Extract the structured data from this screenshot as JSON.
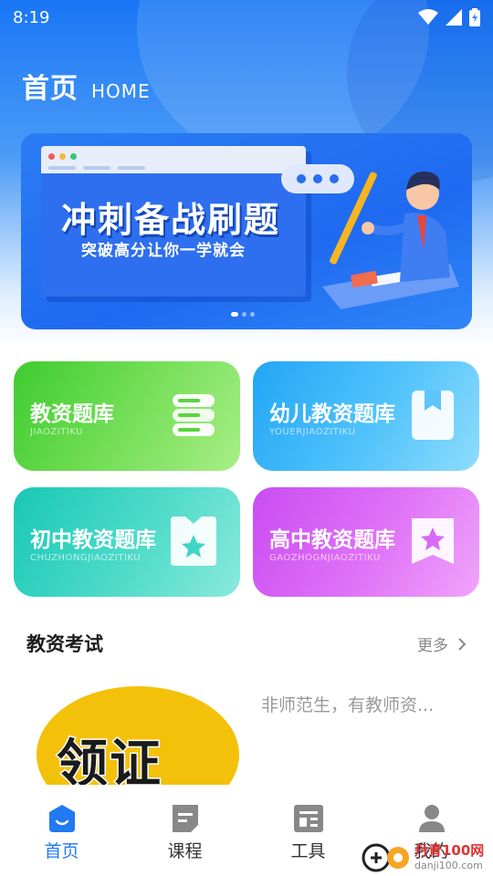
{
  "status_bar": {
    "time": "8:19"
  },
  "header": {
    "title": "首页",
    "subtitle": "HOME"
  },
  "banner": {
    "title": "冲刺备战刷题",
    "subtitle": "突破高分让你一学就会",
    "page_count": 3,
    "active_page": 1
  },
  "categories": [
    {
      "title": "教资题库",
      "subtitle": "JIAOZITIKU",
      "icon": "books-icon",
      "color": "#3fcc2f"
    },
    {
      "title": "幼儿教资题库",
      "subtitle": "YOUERJIAOZITIKU",
      "icon": "book-bookmark-icon",
      "color": "#22a6f6"
    },
    {
      "title": "初中教资题库",
      "subtitle": "CHUZHONGJIAOZITIKU",
      "icon": "star-bookmark-icon",
      "color": "#19c8b5"
    },
    {
      "title": "高中教资题库",
      "subtitle": "GAOZHOGNJIAOZITIKU",
      "icon": "star-bookmark-icon",
      "color": "#c94cf2"
    }
  ],
  "section": {
    "title": "教资考试",
    "more_label": "更多"
  },
  "course": {
    "thumb_text": "领证",
    "description": "非师范生，有教师资..."
  },
  "tabs": [
    {
      "label": "首页",
      "icon": "home-icon",
      "active": true
    },
    {
      "label": "课程",
      "icon": "course-icon",
      "active": false
    },
    {
      "label": "工具",
      "icon": "tools-icon",
      "active": false
    },
    {
      "label": "我的",
      "icon": "profile-icon",
      "active": false
    }
  ],
  "watermark": {
    "name": "丹青100网",
    "url": "danji100.com"
  },
  "colors": {
    "accent": "#2279f2",
    "header_blue": "#1976f5",
    "inactive_tab": "#888888"
  }
}
